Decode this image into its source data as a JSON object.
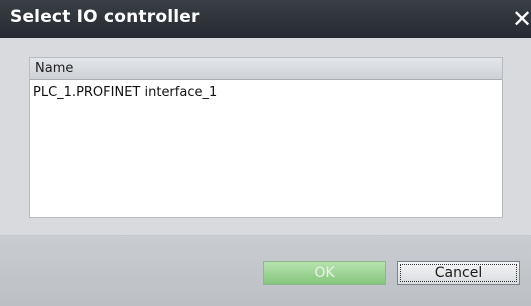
{
  "dialog": {
    "title": "Select IO controller",
    "close_glyph": "✕"
  },
  "list": {
    "column_header": "Name",
    "rows": [
      {
        "name": "PLC_1.PROFINET interface_1"
      }
    ]
  },
  "buttons": {
    "ok_label": "OK",
    "ok_enabled": false,
    "cancel_label": "Cancel"
  },
  "colors": {
    "titlebar": "#2c3037",
    "ok_button": "#9fd596",
    "background": "#d8dadd"
  }
}
